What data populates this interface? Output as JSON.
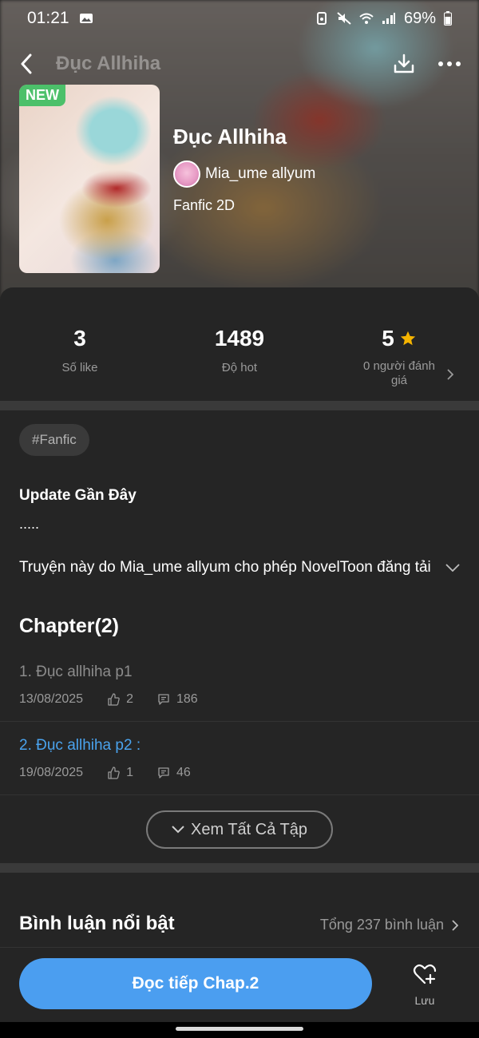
{
  "status_bar": {
    "time": "01:21",
    "battery": "69%"
  },
  "nav": {
    "title": "Đục Allhiha"
  },
  "book": {
    "badge": "NEW",
    "title": "Đục Allhiha",
    "author": "Mia_ume allyum",
    "genre": "Fanfic 2D"
  },
  "stats": [
    {
      "value": "3",
      "label": "Số like"
    },
    {
      "value": "1489",
      "label": "Độ hot"
    },
    {
      "value": "5",
      "label": "0 người đánh giá"
    }
  ],
  "tag": "#Fanfic",
  "update": {
    "title": "Update Gần Đây",
    "text": "....."
  },
  "description": "Truyện này do Mia_ume allyum cho phép NovelToon đăng tải",
  "chapters_heading": "Chapter(2)",
  "chapters": [
    {
      "name": "1. Đục allhiha p1",
      "date": "13/08/2025",
      "likes": "2",
      "comments": "186",
      "current": false
    },
    {
      "name": "2. Đục allhiha p2 :",
      "date": "19/08/2025",
      "likes": "1",
      "comments": "46",
      "current": true
    }
  ],
  "view_all_label": "Xem Tất Cả Tập",
  "comments": {
    "title": "Bình luận nổi bật",
    "total": "Tổng 237 bình luận"
  },
  "bottom": {
    "read_label": "Đọc tiếp Chap.2",
    "save_label": "Lưu"
  },
  "colors": {
    "accent": "#4b9ef0",
    "badge": "#4cc06a",
    "star": "#f5b400",
    "background": "#252525"
  },
  "icons": [
    "back-icon",
    "download-icon",
    "more-icon",
    "star-icon",
    "chevron-right-icon",
    "chevron-down-icon",
    "thumb-up-icon",
    "comment-icon",
    "heart-plus-icon"
  ]
}
